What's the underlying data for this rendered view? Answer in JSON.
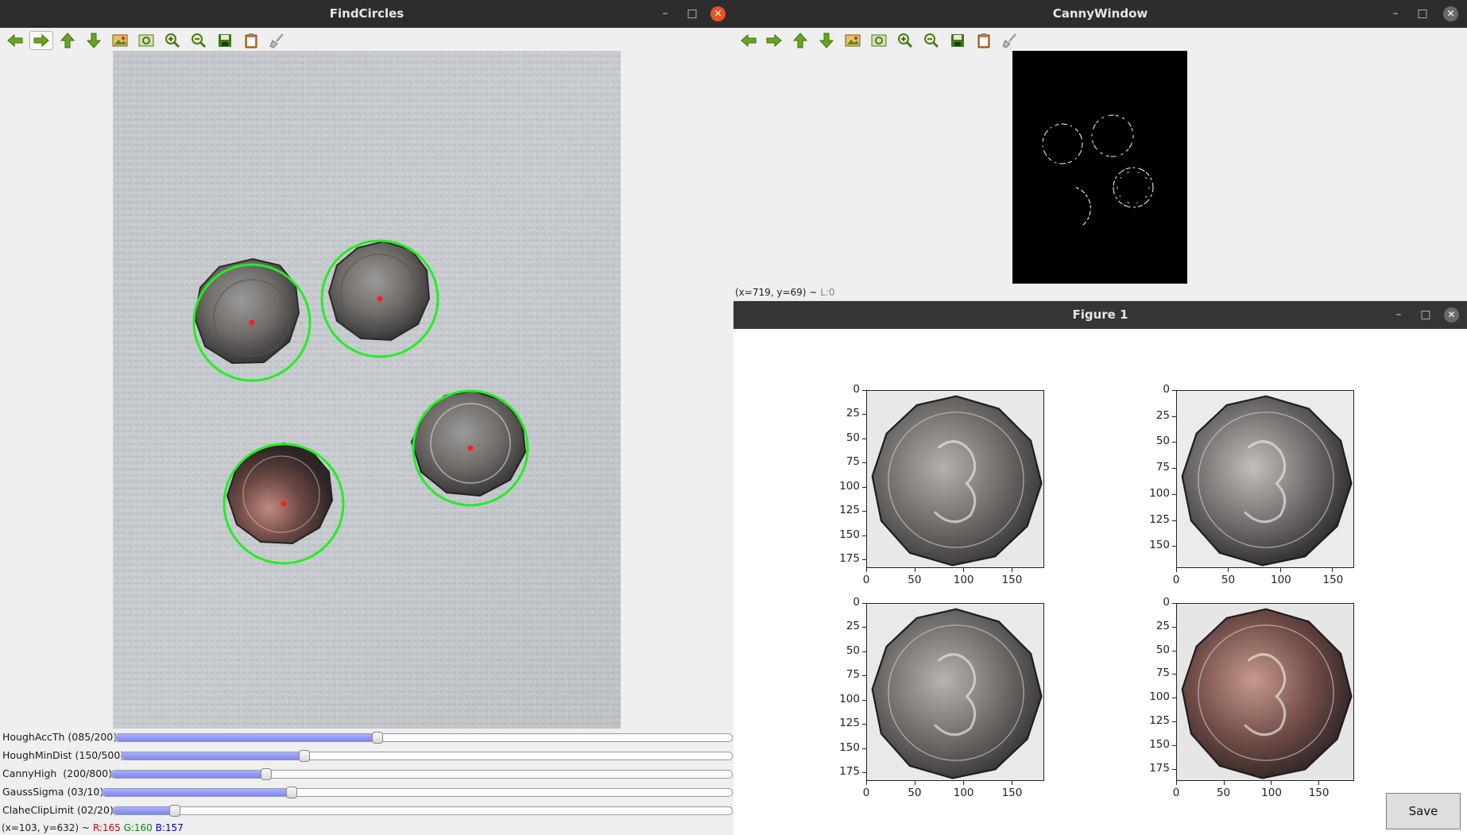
{
  "findcircles": {
    "title": "FindCircles",
    "window_controls": {
      "minimize": "–",
      "maximize": "□",
      "close": "✕"
    },
    "toolbar": [
      "back-arrow-icon",
      "forward-arrow-icon",
      "up-arrow-icon",
      "down-arrow-icon",
      "image-icon",
      "fit-icon",
      "zoom-in-icon",
      "zoom-out-icon",
      "save-icon",
      "clipboard-icon",
      "brush-icon"
    ],
    "detected_circles": 4,
    "sliders": [
      {
        "label": "HoughAccTh (085/200)",
        "value": 85,
        "max": 200
      },
      {
        "label": "HoughMinDist (150/500)",
        "value": 150,
        "max": 500
      },
      {
        "label": "CannyHigh  (200/800)",
        "value": 200,
        "max": 800
      },
      {
        "label": "GaussSigma (03/10)",
        "value": 3,
        "max": 10
      },
      {
        "label": "ClaheClipLimit (02/20)",
        "value": 2,
        "max": 20
      }
    ],
    "status": {
      "coords": "(x=103, y=632) ~",
      "r": "R:165",
      "g": "G:160",
      "b": "B:157"
    }
  },
  "canny": {
    "title": "CannyWindow",
    "window_controls": {
      "minimize": "–",
      "maximize": "□",
      "close": "✕"
    },
    "status": {
      "coords": "(x=719, y=69) ~",
      "l": "L:0"
    }
  },
  "figure": {
    "title": "Figure 1",
    "window_controls": {
      "minimize": "–",
      "maximize": "□",
      "close": "✕"
    },
    "save_label": "Save",
    "subplots": [
      {
        "yticks": [
          "0",
          "25",
          "50",
          "75",
          "100",
          "125",
          "150",
          "175"
        ],
        "xticks": [
          "0",
          "50",
          "100",
          "150"
        ],
        "size": 184
      },
      {
        "yticks": [
          "0",
          "25",
          "50",
          "75",
          "100",
          "125",
          "150"
        ],
        "xticks": [
          "0",
          "50",
          "100",
          "150"
        ],
        "size": 171
      },
      {
        "yticks": [
          "0",
          "25",
          "50",
          "75",
          "100",
          "125",
          "150",
          "175"
        ],
        "xticks": [
          "0",
          "50",
          "100",
          "150"
        ],
        "size": 184
      },
      {
        "yticks": [
          "0",
          "25",
          "50",
          "75",
          "100",
          "125",
          "150",
          "175"
        ],
        "xticks": [
          "0",
          "50",
          "100",
          "150"
        ],
        "size": 188
      }
    ]
  },
  "colors": {
    "titlebar": "#2d2d2d",
    "close": "#e95420",
    "circle": "#22ee22",
    "center": "#ff2020",
    "r": "#e00000",
    "g": "#009000",
    "b": "#0000d0"
  }
}
